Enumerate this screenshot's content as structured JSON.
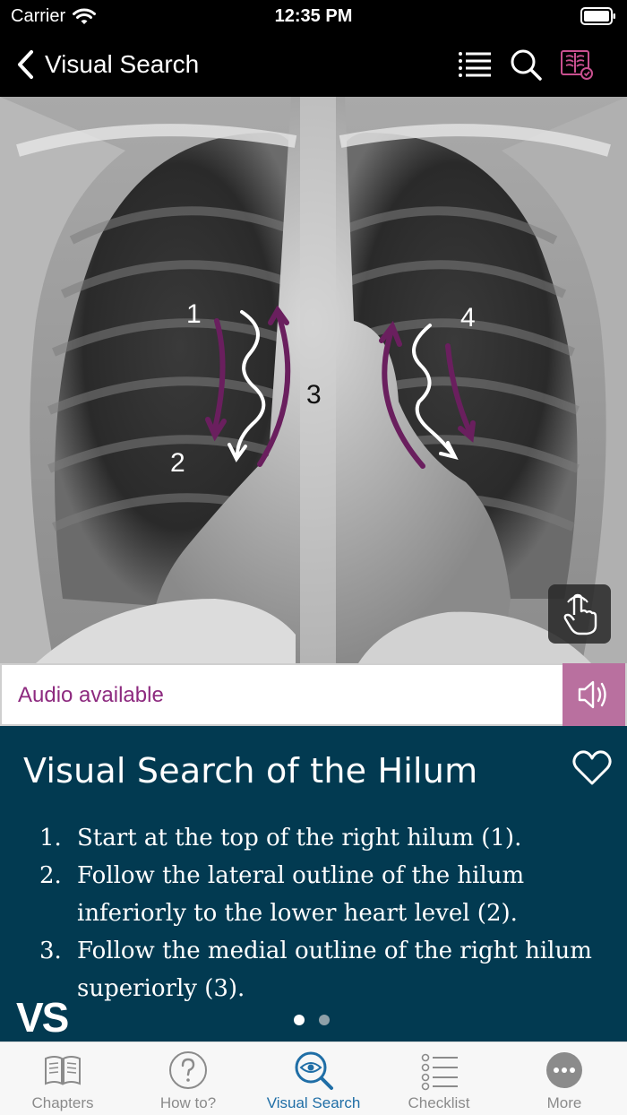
{
  "status_bar": {
    "carrier": "Carrier",
    "time": "12:35 PM"
  },
  "nav": {
    "back_title": "Visual Search",
    "icons": [
      "list-icon",
      "search-icon",
      "xray-checklist-icon"
    ]
  },
  "xray": {
    "labels": [
      "1",
      "2",
      "3",
      "4"
    ]
  },
  "audio": {
    "label": "Audio available",
    "icon": "speaker-icon"
  },
  "content": {
    "title": "Visual Search of the Hilum",
    "steps": [
      {
        "num": "1.",
        "text": "Start at the top of the right hilum (1)."
      },
      {
        "num": "2.",
        "text": "Follow the lateral outline of the hilum inferiorly to the lower heart level (2)."
      },
      {
        "num": "3.",
        "text": "Follow the medial outline of the right hilum superiorly (3)."
      }
    ],
    "logo": "VS",
    "page_index": 1,
    "page_count": 2
  },
  "tabs": [
    {
      "label": "Chapters",
      "icon": "book-icon"
    },
    {
      "label": "How to?",
      "icon": "question-icon"
    },
    {
      "label": "Visual Search",
      "icon": "eye-search-icon",
      "active": true
    },
    {
      "label": "Checklist",
      "icon": "checklist-icon"
    },
    {
      "label": "More",
      "icon": "more-icon"
    }
  ],
  "colors": {
    "accent": "#8d2a7f",
    "panel": "#023a51",
    "active_tab": "#1f6ea6",
    "audio_button": "#b9709f"
  }
}
